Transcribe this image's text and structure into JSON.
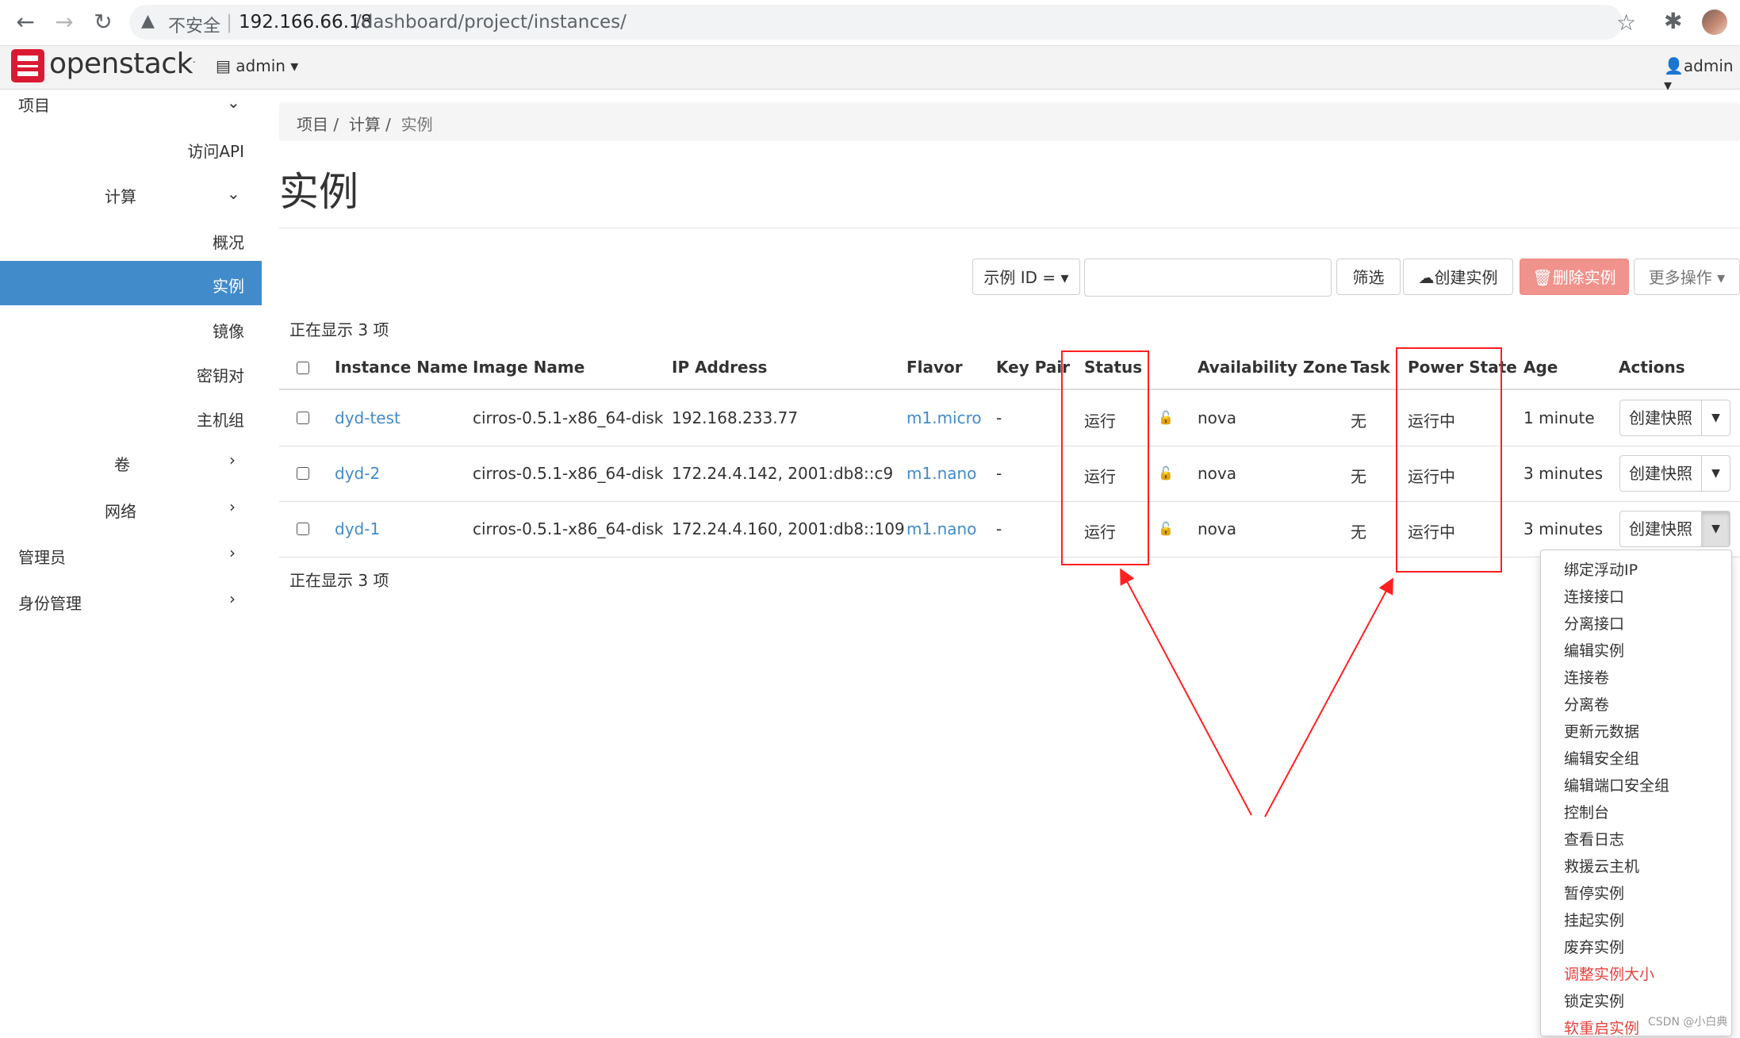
{
  "browser": {
    "insecure_label": "不安全",
    "url_host": "192.166.66.18",
    "url_path": "/dashboard/project/instances/"
  },
  "header": {
    "logo_text": "openstack",
    "project": "admin",
    "user": "admin"
  },
  "sidebar": {
    "project": "项目",
    "access_api": "访问API",
    "compute": "计算",
    "overview": "概况",
    "instances": "实例",
    "images": "镜像",
    "keypairs": "密钥对",
    "server_groups": "主机组",
    "volumes": "卷",
    "network": "网络",
    "admin": "管理员",
    "identity": "身份管理"
  },
  "breadcrumb": [
    "项目",
    "计算",
    "实例"
  ],
  "page_title": "实例",
  "toolbar": {
    "filter_field": "示例 ID = ▾",
    "filter_label": "筛选",
    "create_label": "创建实例",
    "delete_label": "删除实例",
    "more_label": "更多操作 ▾"
  },
  "count_text": "正在显示 3 项",
  "table": {
    "columns": [
      "Instance Name",
      "Image Name",
      "IP Address",
      "Flavor",
      "Key Pair",
      "Status",
      "Availability Zone",
      "Task",
      "Power State",
      "Age",
      "Actions"
    ],
    "rows": [
      {
        "name": "dyd-test",
        "image": "cirros-0.5.1-x86_64-disk",
        "ip": "192.168.233.77",
        "flavor": "m1.micro",
        "keypair": "-",
        "status": "运行",
        "zone": "nova",
        "task": "无",
        "power": "运行中",
        "age": "1 minute",
        "action": "创建快照"
      },
      {
        "name": "dyd-2",
        "image": "cirros-0.5.1-x86_64-disk",
        "ip": "172.24.4.142, 2001:db8::c9",
        "flavor": "m1.nano",
        "keypair": "-",
        "status": "运行",
        "zone": "nova",
        "task": "无",
        "power": "运行中",
        "age": "3 minutes",
        "action": "创建快照"
      },
      {
        "name": "dyd-1",
        "image": "cirros-0.5.1-x86_64-disk",
        "ip": "172.24.4.160, 2001:db8::109",
        "flavor": "m1.nano",
        "keypair": "-",
        "status": "运行",
        "zone": "nova",
        "task": "无",
        "power": "运行中",
        "age": "3 minutes",
        "action": "创建快照"
      }
    ]
  },
  "dropdown_items": [
    {
      "label": "绑定浮动IP"
    },
    {
      "label": "连接接口"
    },
    {
      "label": "分离接口"
    },
    {
      "label": "编辑实例"
    },
    {
      "label": "连接卷"
    },
    {
      "label": "分离卷"
    },
    {
      "label": "更新元数据"
    },
    {
      "label": "编辑安全组"
    },
    {
      "label": "编辑端口安全组"
    },
    {
      "label": "控制台"
    },
    {
      "label": "查看日志"
    },
    {
      "label": "救援云主机"
    },
    {
      "label": "暂停实例"
    },
    {
      "label": "挂起实例"
    },
    {
      "label": "废弃实例"
    },
    {
      "label": "调整实例大小",
      "danger": true
    },
    {
      "label": "锁定实例"
    },
    {
      "label": "软重启实例",
      "danger": true
    }
  ],
  "watermark": "CSDN @小白典",
  "colors": {
    "accent": "#428bca",
    "danger": "#e4433c",
    "highlight": "#ff2020",
    "brand": "#da1a32"
  }
}
